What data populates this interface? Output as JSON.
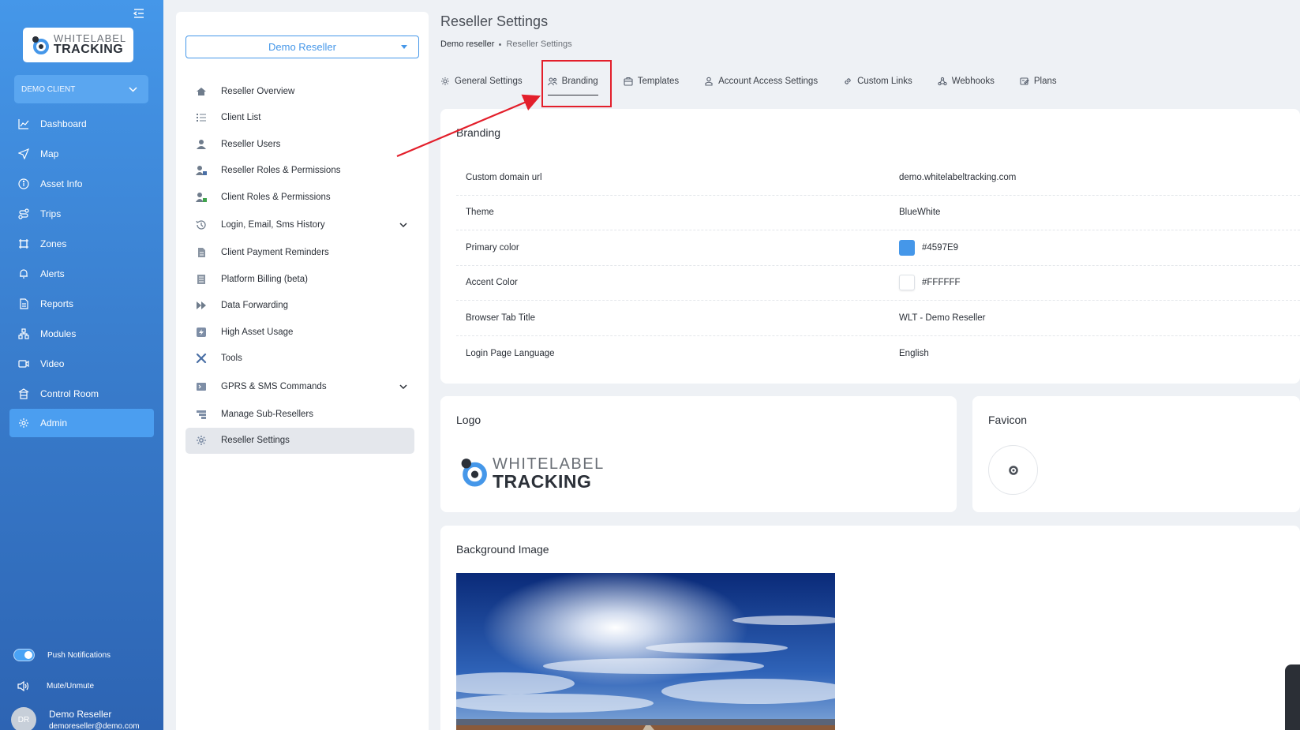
{
  "sidebar": {
    "logo": {
      "top": "WHITELABEL",
      "bottom": "TRACKING"
    },
    "client_select": "DEMO CLIENT",
    "items": [
      {
        "label": "Dashboard",
        "icon": "chart-line-icon"
      },
      {
        "label": "Map",
        "icon": "navigation-arrow-icon"
      },
      {
        "label": "Asset Info",
        "icon": "info-circle-icon"
      },
      {
        "label": "Trips",
        "icon": "route-icon"
      },
      {
        "label": "Zones",
        "icon": "zone-icon"
      },
      {
        "label": "Alerts",
        "icon": "bell-icon"
      },
      {
        "label": "Reports",
        "icon": "document-icon"
      },
      {
        "label": "Modules",
        "icon": "modules-icon"
      },
      {
        "label": "Video",
        "icon": "video-camera-icon"
      },
      {
        "label": "Control Room",
        "icon": "control-room-icon"
      },
      {
        "label": "Admin",
        "icon": "gear-icon"
      }
    ],
    "push_notifications": "Push Notifications",
    "mute": "Mute/Unmute",
    "user": {
      "initials": "DR",
      "name": "Demo Reseller",
      "email": "demoreseller@demo.com"
    }
  },
  "panel": {
    "reseller_select": "Demo Reseller",
    "items": [
      {
        "label": "Reseller Overview"
      },
      {
        "label": "Client List"
      },
      {
        "label": "Reseller Users"
      },
      {
        "label": "Reseller Roles & Permissions"
      },
      {
        "label": "Client Roles & Permissions"
      },
      {
        "label": "Login, Email, Sms History"
      },
      {
        "label": "Client Payment Reminders"
      },
      {
        "label": "Platform Billing (beta)"
      },
      {
        "label": "Data Forwarding"
      },
      {
        "label": "High Asset Usage"
      },
      {
        "label": "Tools"
      },
      {
        "label": "GPRS & SMS Commands"
      },
      {
        "label": "Manage Sub-Resellers"
      },
      {
        "label": "Reseller Settings"
      }
    ]
  },
  "main": {
    "title": "Reseller Settings",
    "breadcrumb": {
      "parent": "Demo reseller",
      "current": "Reseller Settings"
    },
    "tabs": [
      {
        "label": "General Settings"
      },
      {
        "label": "Branding"
      },
      {
        "label": "Templates"
      },
      {
        "label": "Account Access Settings"
      },
      {
        "label": "Custom Links"
      },
      {
        "label": "Webhooks"
      },
      {
        "label": "Plans"
      }
    ],
    "branding": {
      "title": "Branding",
      "rows": [
        {
          "key": "Custom domain url",
          "value": "demo.whitelabeltracking.com"
        },
        {
          "key": "Theme",
          "value": "BlueWhite"
        },
        {
          "key": "Primary color",
          "value": "#4597E9"
        },
        {
          "key": "Accent Color",
          "value": "#FFFFFF"
        },
        {
          "key": "Browser Tab Title",
          "value": "WLT - Demo Reseller"
        },
        {
          "key": "Login Page Language",
          "value": "English"
        }
      ]
    },
    "logo_card": {
      "title": "Logo",
      "logo_top": "WHITELABEL",
      "logo_bottom": "TRACKING"
    },
    "favicon_card": {
      "title": "Favicon"
    },
    "background_card": {
      "title": "Background Image"
    }
  },
  "colors": {
    "primary": "#4597E9",
    "accent": "#FFFFFF",
    "highlight": "#E31F2B"
  }
}
